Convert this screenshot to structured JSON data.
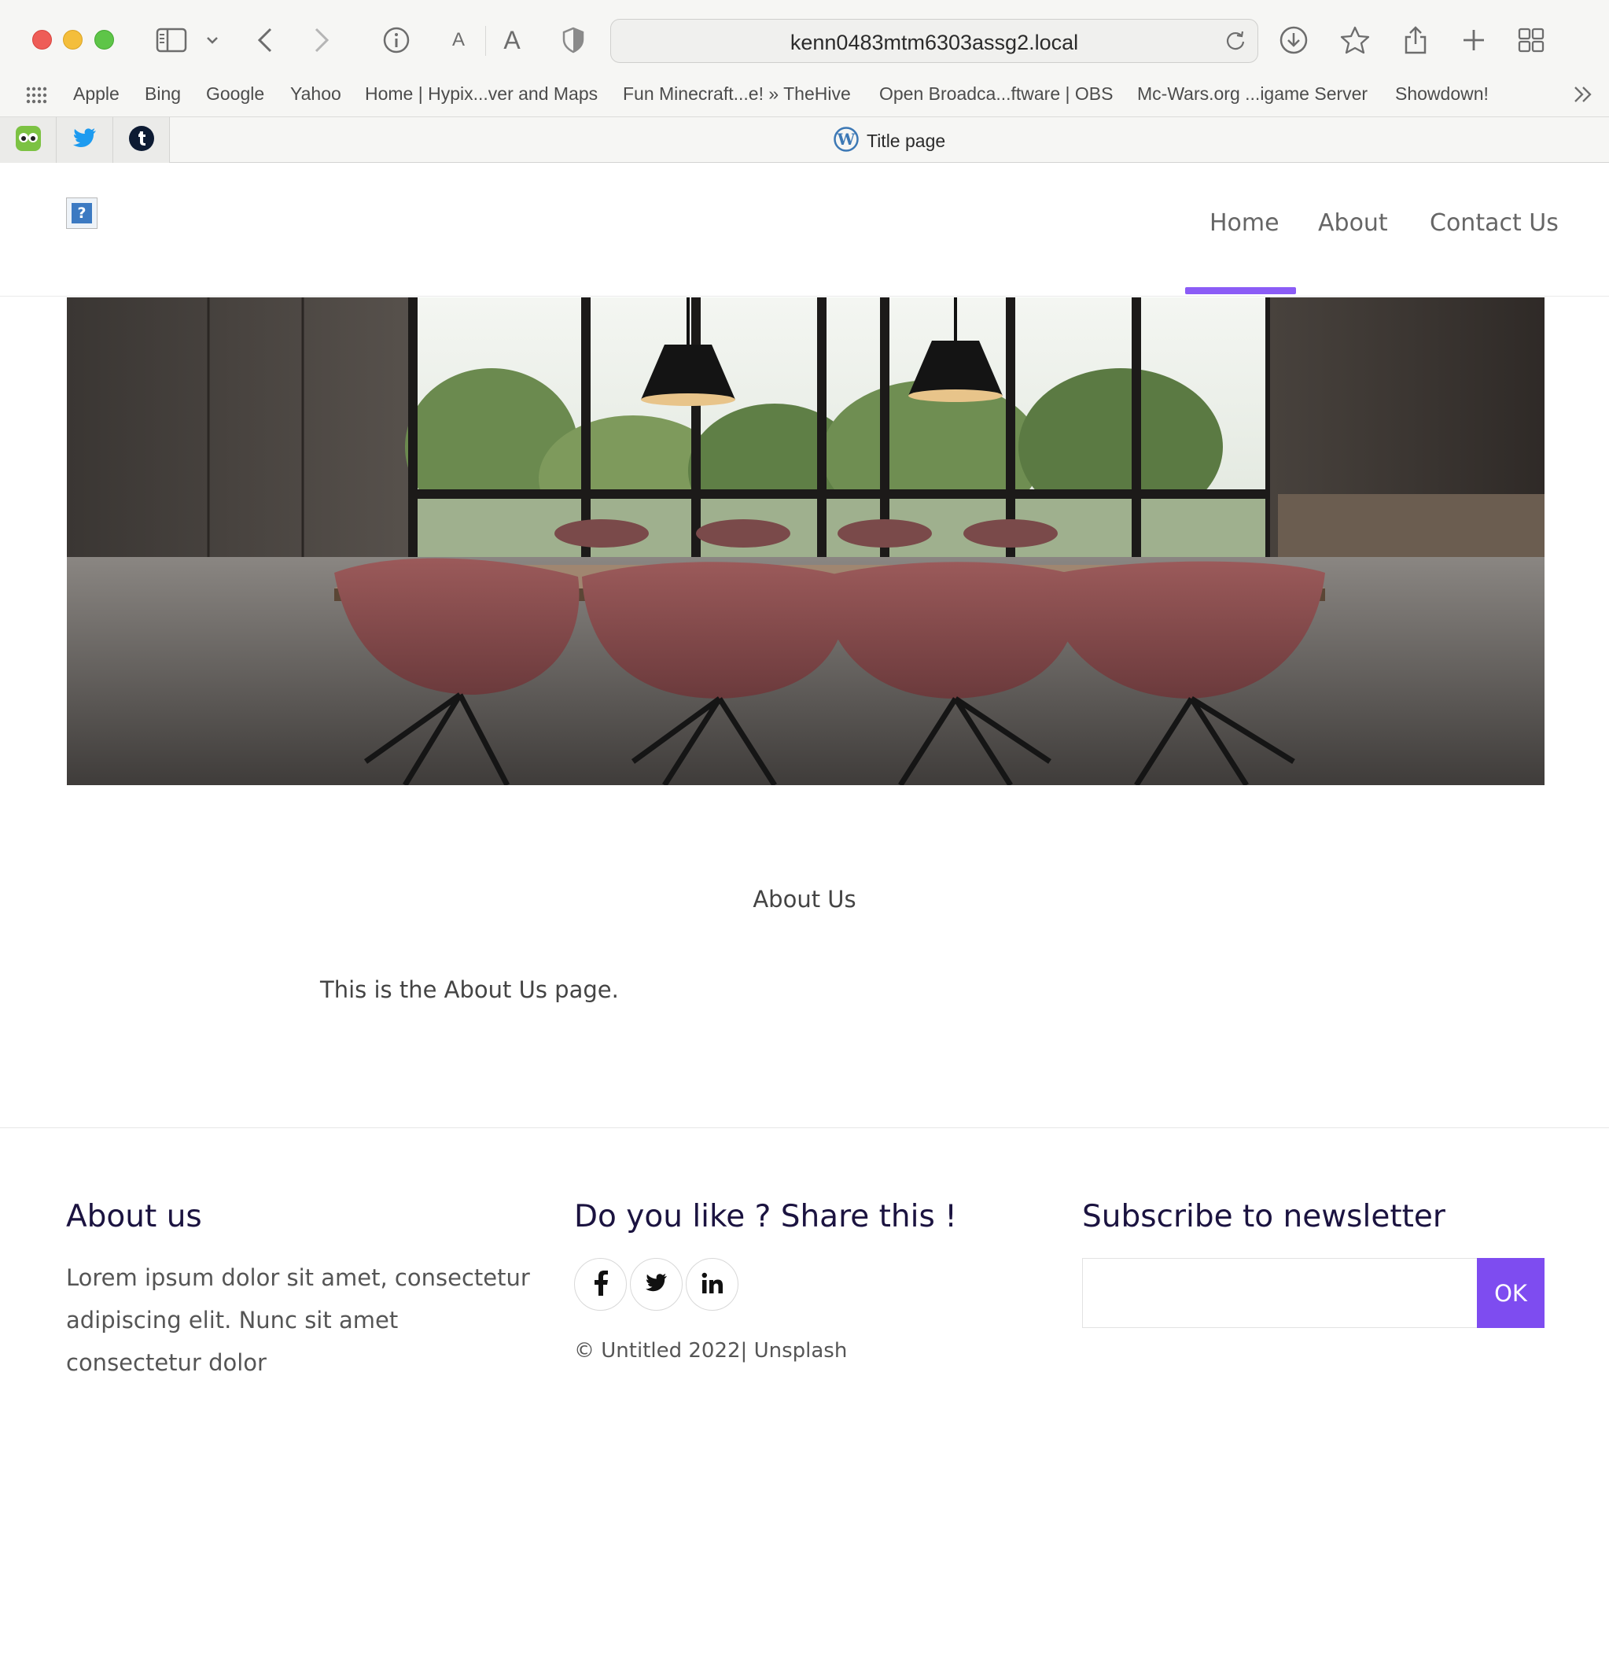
{
  "browser": {
    "url": "kenn0483mtm6303assg2.local",
    "text_size_small": "A",
    "text_size_large": "A",
    "bookmarks": [
      "Apple",
      "Bing",
      "Google",
      "Yahoo",
      "Home | Hypix...ver and Maps",
      "Fun Minecraft...e! » TheHive",
      "Open Broadca...ftware | OBS",
      "Mc-Wars.org ...igame Server",
      "Showdown!"
    ],
    "active_tab_title": "Title page"
  },
  "site": {
    "nav": [
      "Home",
      "About",
      "Contact Us"
    ],
    "active_nav": "Home",
    "accent_color": "#8b5cf6",
    "logo_placeholder": "?"
  },
  "content": {
    "title": "About Us",
    "text": "This is the About Us page."
  },
  "footer": {
    "about_heading": "About us",
    "about_text": "Lorem ipsum dolor sit amet, consectetur adipiscing elit. Nunc sit amet consectetur dolor",
    "share_heading": "Do you like ? Share this !",
    "social_icons": [
      "facebook-icon",
      "twitter-icon",
      "linkedin-icon"
    ],
    "copyright": "© Untitled 2022| Unsplash",
    "newsletter_heading": "Subscribe to newsletter",
    "newsletter_button": "OK"
  }
}
